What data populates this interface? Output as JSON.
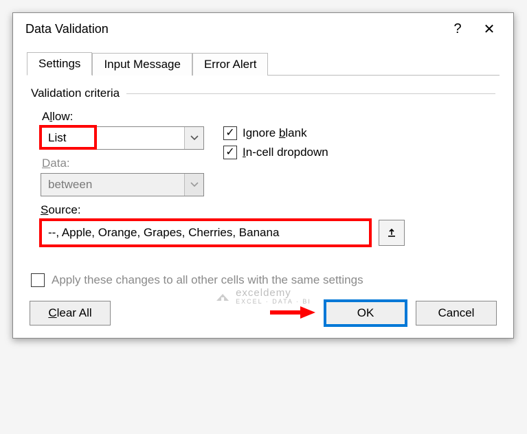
{
  "dialog": {
    "title": "Data Validation",
    "help_symbol": "?",
    "close_symbol": "✕"
  },
  "tabs": {
    "settings": "Settings",
    "input_message": "Input Message",
    "error_alert": "Error Alert"
  },
  "group": {
    "criteria_label": "Validation criteria"
  },
  "fields": {
    "allow_label_pre": "A",
    "allow_label_u": "l",
    "allow_label_post": "low:",
    "allow_value": "List",
    "data_label_pre": "",
    "data_label_u": "D",
    "data_label_post": "ata:",
    "data_value": "between",
    "source_label_pre": "",
    "source_label_u": "S",
    "source_label_post": "ource:",
    "source_value": "--, Apple, Orange, Grapes, Cherries, Banana"
  },
  "checks": {
    "ignore_blank_pre": "Ignore ",
    "ignore_blank_u": "b",
    "ignore_blank_post": "lank",
    "incell_pre": "",
    "incell_u": "I",
    "incell_post": "n-cell dropdown",
    "check_glyph": "✓"
  },
  "apply": {
    "label_pre": "Apply these changes to all other cells with the same settings"
  },
  "footer": {
    "clear_pre": "",
    "clear_u": "C",
    "clear_post": "lear All",
    "ok": "OK",
    "cancel": "Cancel"
  },
  "watermark": {
    "name": "exceldemy",
    "sub": "EXCEL · DATA · BI"
  },
  "colors": {
    "highlight_red": "#ff0000",
    "highlight_blue": "#0078d7"
  }
}
